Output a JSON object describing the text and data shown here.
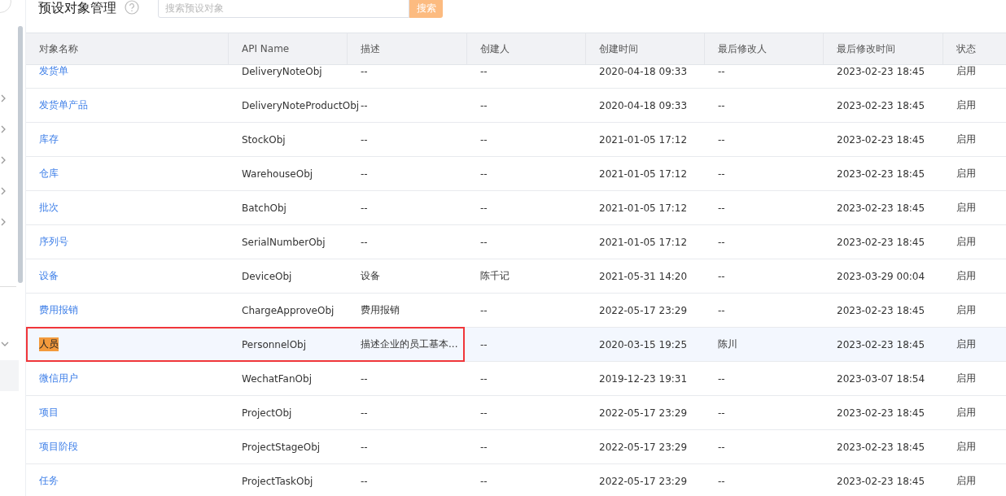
{
  "header": {
    "title": "预设对象管理",
    "search": {
      "placeholder": "搜索预设对象"
    },
    "search_button": "搜索"
  },
  "table": {
    "columns": [
      "对象名称",
      "API Name",
      "描述",
      "创建人",
      "创建时间",
      "最后修改人",
      "最后修改时间",
      "状态"
    ],
    "rows": [
      {
        "cells": [
          "发货单",
          "DeliveryNoteObj",
          "--",
          "--",
          "2020-04-18 09:33",
          "--",
          "2023-02-23 18:45",
          "启用"
        ],
        "selected": false
      },
      {
        "cells": [
          "发货单产品",
          "DeliveryNoteProductObj",
          "--",
          "--",
          "2020-04-18 09:33",
          "--",
          "2023-02-23 18:45",
          "启用"
        ],
        "selected": false
      },
      {
        "cells": [
          "库存",
          "StockObj",
          "--",
          "--",
          "2021-01-05 17:12",
          "--",
          "2023-02-23 18:45",
          "启用"
        ],
        "selected": false
      },
      {
        "cells": [
          "仓库",
          "WarehouseObj",
          "--",
          "--",
          "2021-01-05 17:12",
          "--",
          "2023-02-23 18:45",
          "启用"
        ],
        "selected": false
      },
      {
        "cells": [
          "批次",
          "BatchObj",
          "--",
          "--",
          "2021-01-05 17:12",
          "--",
          "2023-02-23 18:45",
          "启用"
        ],
        "selected": false
      },
      {
        "cells": [
          "序列号",
          "SerialNumberObj",
          "--",
          "--",
          "2021-01-05 17:12",
          "--",
          "2023-02-23 18:45",
          "启用"
        ],
        "selected": false
      },
      {
        "cells": [
          "设备",
          "DeviceObj",
          "设备",
          "陈千记",
          "2021-05-31 14:20",
          "--",
          "2023-03-29 00:04",
          "启用"
        ],
        "selected": false
      },
      {
        "cells": [
          "费用报销",
          "ChargeApproveObj",
          "费用报销",
          "--",
          "2022-05-17 23:29",
          "--",
          "2023-02-23 18:45",
          "启用"
        ],
        "selected": false
      },
      {
        "cells": [
          "人员",
          "PersonnelObj",
          "描述企业的员工基本...",
          "--",
          "2020-03-15 19:25",
          "陈川",
          "2023-02-23 18:45",
          "启用"
        ],
        "selected": true
      },
      {
        "cells": [
          "微信用户",
          "WechatFanObj",
          "--",
          "--",
          "2019-12-23 19:31",
          "--",
          "2023-03-07 18:54",
          "启用"
        ],
        "selected": false
      },
      {
        "cells": [
          "项目",
          "ProjectObj",
          "--",
          "--",
          "2022-05-17 23:29",
          "--",
          "2023-02-23 18:45",
          "启用"
        ],
        "selected": false
      },
      {
        "cells": [
          "项目阶段",
          "ProjectStageObj",
          "--",
          "--",
          "2022-05-17 23:29",
          "--",
          "2023-02-23 18:45",
          "启用"
        ],
        "selected": false
      },
      {
        "cells": [
          "任务",
          "ProjectTaskObj",
          "--",
          "--",
          "2022-05-17 23:29",
          "--",
          "2023-02-23 18:45",
          "启用"
        ],
        "selected": false
      }
    ]
  }
}
